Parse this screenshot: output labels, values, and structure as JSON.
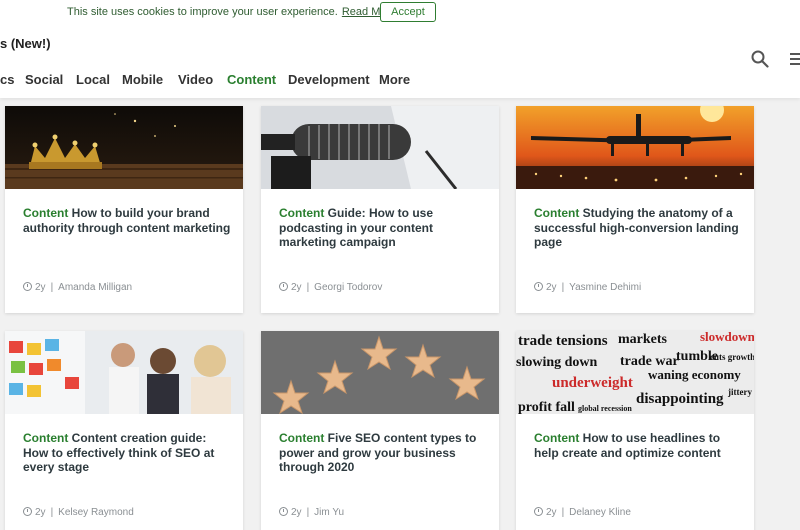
{
  "cookie": {
    "message": "This site uses cookies to improve your user experience.",
    "read_more": "Read More",
    "accept": "Accept"
  },
  "brand": "s (New!)",
  "nav": [
    {
      "label": "cs",
      "active": false
    },
    {
      "label": "Social",
      "active": false
    },
    {
      "label": "Local",
      "active": false
    },
    {
      "label": "Mobile",
      "active": false
    },
    {
      "label": "Video",
      "active": false
    },
    {
      "label": "Content",
      "active": true
    },
    {
      "label": "Development",
      "active": false
    },
    {
      "label": "More",
      "active": false
    }
  ],
  "icons": {
    "search": "search-icon",
    "menu": "hamburger-menu-icon",
    "clock": "clock-icon"
  },
  "colors": {
    "accent": "#2a7f2f",
    "text": "#2e3a3f",
    "meta": "#8a8f93",
    "background": "#f1f1f1"
  },
  "articles": [
    {
      "category": "Content",
      "title": "How to build your brand authority through content marketing",
      "age": "2y",
      "author": "Amanda Milligan",
      "image": "golden-crown"
    },
    {
      "category": "Content",
      "title": "Guide: How to use podcasting in your content marketing campaign",
      "age": "2y",
      "author": "Georgi Todorov",
      "image": "podcast-microphone"
    },
    {
      "category": "Content",
      "title": "Studying the anatomy of a successful high-conversion landing page",
      "age": "2y",
      "author": "Yasmine Dehimi",
      "image": "airplane-landing-sunset"
    },
    {
      "category": "Content",
      "title": "Content creation guide: How to effectively think of SEO at every stage",
      "age": "2y",
      "author": "Kelsey Raymond",
      "image": "team-sticky-notes"
    },
    {
      "category": "Content",
      "title": "Five SEO content types to power and grow your business through 2020",
      "age": "2y",
      "author": "Jim Yu",
      "image": "five-stars"
    },
    {
      "category": "Content",
      "title": "How to use headlines to help create and optimize content",
      "age": "2y",
      "author": "Delaney Kline",
      "image": "newspaper-headlines"
    }
  ],
  "headline_words": [
    "trade tensions",
    "markets",
    "slowdown",
    "slowing down",
    "trade war",
    "tumble",
    "cuts growth",
    "underweight",
    "waning economy",
    "profit fall",
    "global recession",
    "disappointing",
    "jittery"
  ]
}
